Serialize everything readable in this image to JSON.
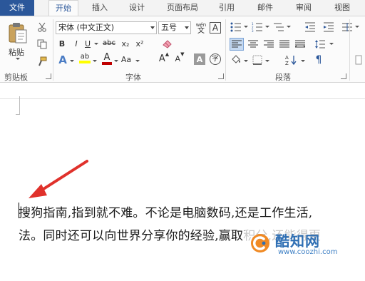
{
  "tabs": [
    {
      "label": "文件"
    },
    {
      "label": "开始"
    },
    {
      "label": "插入"
    },
    {
      "label": "设计"
    },
    {
      "label": "页面布局"
    },
    {
      "label": "引用"
    },
    {
      "label": "邮件"
    },
    {
      "label": "审阅"
    },
    {
      "label": "视图"
    }
  ],
  "ribbon": {
    "clipboard": {
      "paste_label": "粘贴",
      "group_label": "剪贴板"
    },
    "font": {
      "font_name": "宋体 (中文正文)",
      "font_size": "五号",
      "group_label": "字体",
      "bold": "B",
      "italic": "I",
      "underline": "U",
      "strike": "abc",
      "subscript": "x₂",
      "superscript": "x²",
      "grow": "A",
      "shrink": "A",
      "clear": "A",
      "char_border": "A",
      "enclose": "字",
      "phonetic": "wén",
      "phonetic_sub": "文",
      "text_effect": "A",
      "highlight": "ab",
      "font_color": "A",
      "case": "Aa"
    },
    "paragraph": {
      "group_label": "段落"
    }
  },
  "document": {
    "lines": [
      "搜狗指南,指到就不难。不论是电脑数码,还是工作生活,",
      "法。同时还可以向世界分享你的经验,赢取积分,还能得更"
    ]
  },
  "watermark": {
    "title": "酷知网",
    "url": "www.coozhi.com"
  },
  "colors": {
    "accent": "#2b579a",
    "arrow": "#e0312b",
    "font_color_bar": "#c00000",
    "highlight_bar": "#ffff00"
  }
}
